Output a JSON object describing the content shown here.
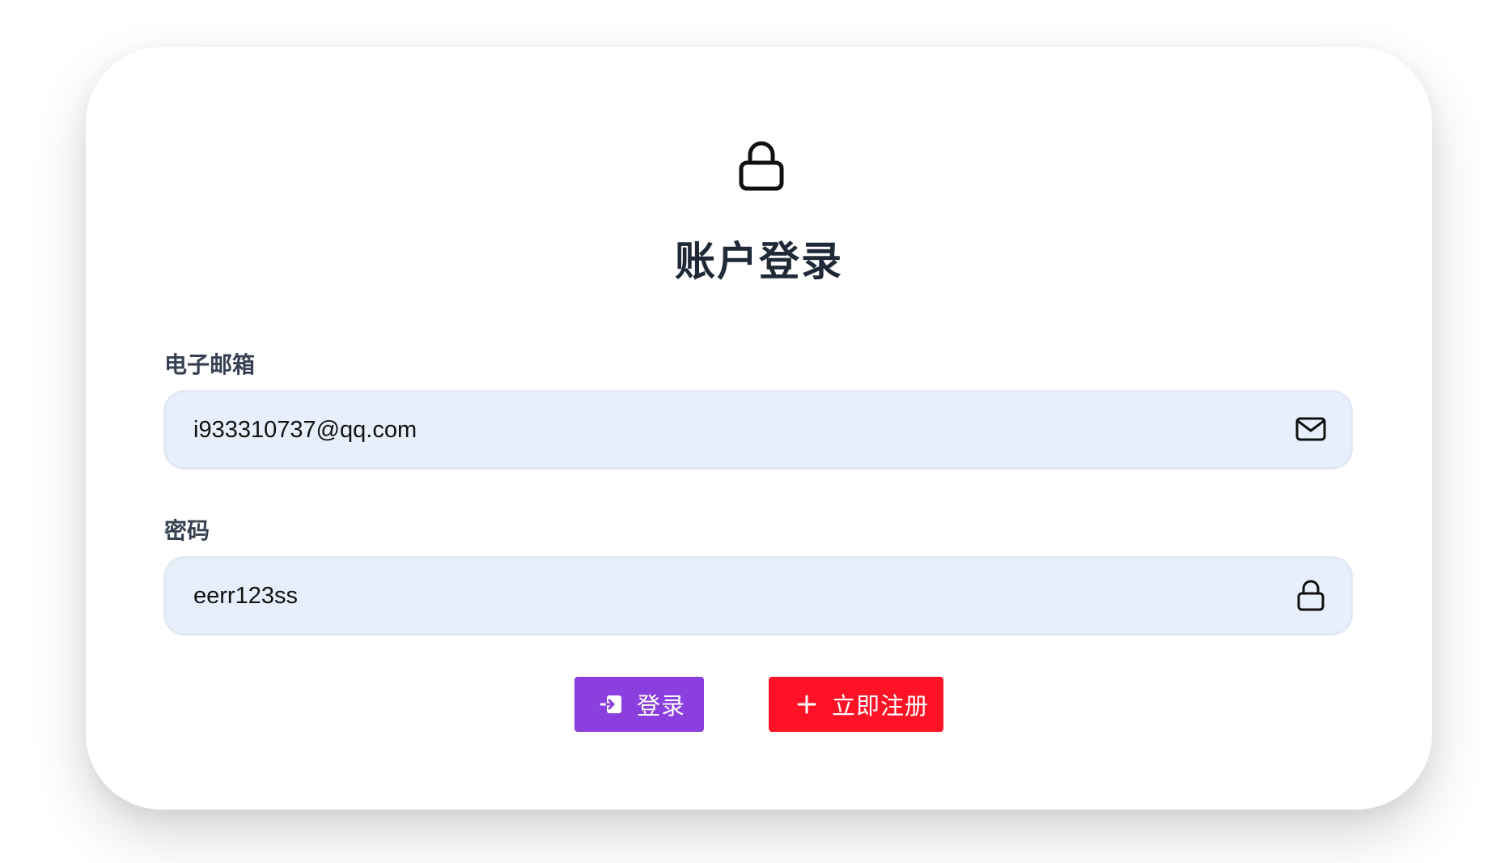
{
  "header": {
    "icon": "lock-icon",
    "title": "账户登录"
  },
  "form": {
    "email": {
      "label": "电子邮箱",
      "value": "i933310737@qq.com",
      "icon": "mail-icon"
    },
    "password": {
      "label": "密码",
      "value": "eerr123ss",
      "icon": "lock-icon"
    }
  },
  "actions": {
    "login": {
      "label": "登录",
      "icon": "login-icon",
      "color": "#8a3fde"
    },
    "register": {
      "label": "立即注册",
      "icon": "plus-icon",
      "color": "#ff1226"
    }
  },
  "colors": {
    "field_background": "#e8effc",
    "title_text": "#1f2937"
  }
}
